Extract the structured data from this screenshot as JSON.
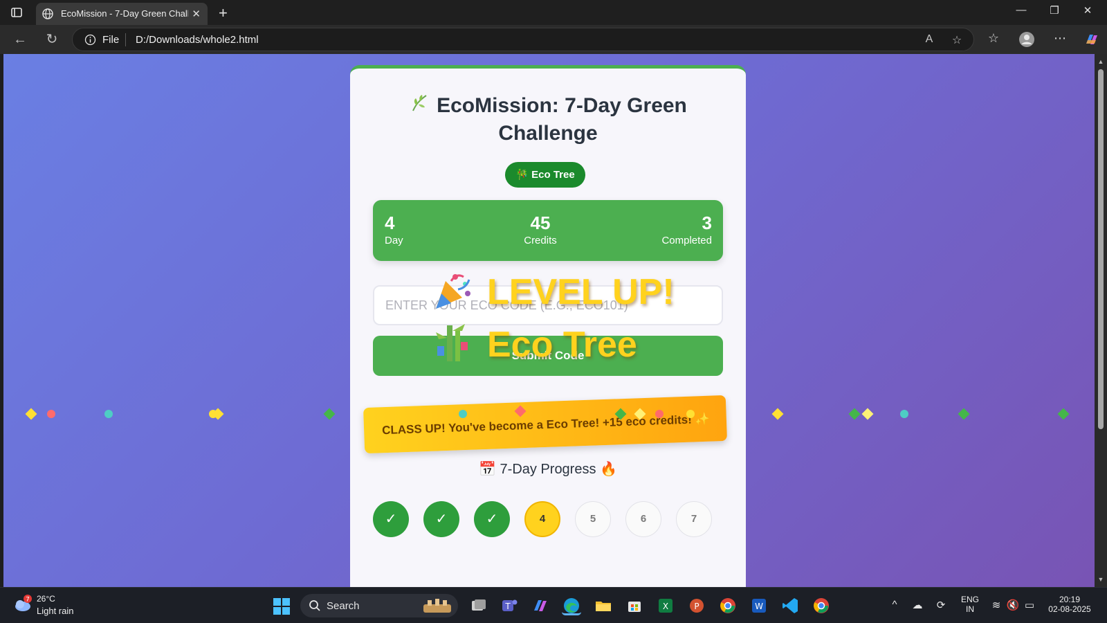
{
  "browser": {
    "tab_title": "EcoMission - 7-Day Green Challer",
    "address_scheme": "File",
    "address_url": "D:/Downloads/whole2.html",
    "minimize_glyph": "—",
    "restore_glyph": "❐",
    "close_glyph": "✕"
  },
  "page": {
    "title_line1": "EcoMission: 7-Day Green",
    "title_line2": "Challenge",
    "badge": "Eco Tree",
    "stats": {
      "day_value": "4",
      "day_label": "Day",
      "credits_value": "45",
      "credits_label": "Credits",
      "completed_value": "3",
      "completed_label": "Completed"
    },
    "code_placeholder": "ENTER YOUR ECO CODE (E.G., ECO101)",
    "submit_label": "Submit Code",
    "levelup_line1": "LEVEL UP!",
    "levelup_line2": "Eco Tree",
    "banner_text": "CLASS UP! You've become a Eco Tree! +15 eco credits! ✨",
    "progress_title": "7-Day Progress",
    "days": [
      {
        "label": "✓",
        "state": "done"
      },
      {
        "label": "✓",
        "state": "done"
      },
      {
        "label": "✓",
        "state": "done"
      },
      {
        "label": "4",
        "state": "current"
      },
      {
        "label": "5",
        "state": "future"
      },
      {
        "label": "6",
        "state": "future"
      },
      {
        "label": "7",
        "state": "future"
      }
    ],
    "colors": {
      "accent_green": "#4caf50",
      "badge_green": "#1b8a2c",
      "gold": "#ffd21e",
      "bg_start": "#6a7fe3",
      "bg_end": "#7854b4"
    }
  },
  "taskbar": {
    "weather_temp": "26°C",
    "weather_desc": "Light rain",
    "weather_alert": "7",
    "search_label": "Search",
    "lang_line1": "ENG",
    "lang_line2": "IN",
    "time": "20:19",
    "date": "02-08-2025"
  }
}
